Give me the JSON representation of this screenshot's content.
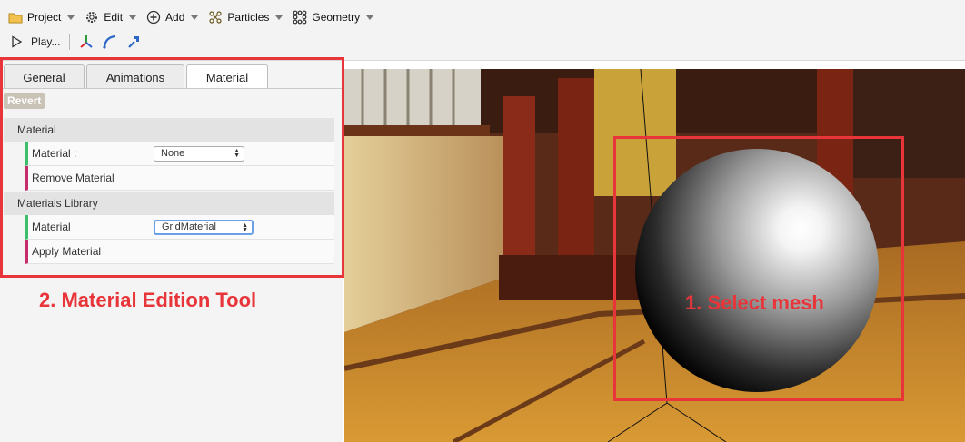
{
  "toolbar": {
    "menus": [
      {
        "label": "Project",
        "icon": "folder-icon"
      },
      {
        "label": "Edit",
        "icon": "gear-icon"
      },
      {
        "label": "Add",
        "icon": "plus-circle-icon"
      },
      {
        "label": "Particles",
        "icon": "particles-icon"
      },
      {
        "label": "Geometry",
        "icon": "geometry-icon"
      }
    ],
    "play_label": "Play...",
    "tools": [
      "axes-icon",
      "curve-icon",
      "pick-icon"
    ]
  },
  "panel": {
    "tabs": [
      {
        "label": "General",
        "active": false
      },
      {
        "label": "Animations",
        "active": false
      },
      {
        "label": "Material",
        "active": true
      }
    ],
    "revert_label": "Revert",
    "sections": [
      {
        "title": "Material",
        "rows": [
          {
            "label": "Material :",
            "type": "select",
            "value": "None"
          },
          {
            "label": "Remove Material",
            "type": "action"
          }
        ]
      },
      {
        "title": "Materials Library",
        "rows": [
          {
            "label": "Material",
            "type": "select",
            "value": "GridMaterial"
          },
          {
            "label": "Apply Material",
            "type": "action"
          }
        ]
      }
    ]
  },
  "annotations": {
    "panel_caption": "2. Material Edition Tool",
    "mesh_caption": "1. Select mesh",
    "highlight_color": "#e8353a"
  },
  "colors": {
    "green_marker": "#3cbf6a",
    "magenta_marker": "#c62d6a"
  }
}
